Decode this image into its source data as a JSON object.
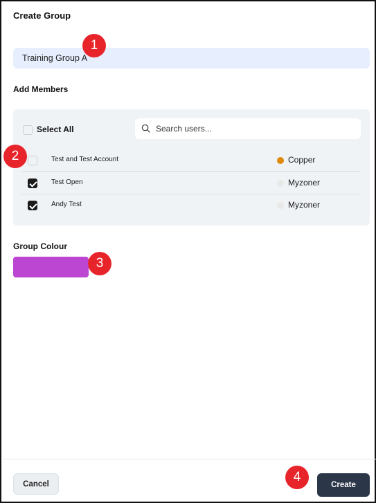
{
  "dialog": {
    "title": "Create Group",
    "group_name_value": "Training Group A"
  },
  "members": {
    "section_label": "Add Members",
    "select_all_label": "Select All",
    "select_all_checked": false,
    "search_placeholder": "Search users...",
    "rows": [
      {
        "name": "Test and Test Account",
        "level": "Copper",
        "checked": false,
        "dot_color": "#e08a0c"
      },
      {
        "name": "Test Open",
        "level": "Myzoner",
        "checked": true,
        "dot_color": "#e8e8e6"
      },
      {
        "name": "Andy Test",
        "level": "Myzoner",
        "checked": true,
        "dot_color": "#e8e8e6"
      }
    ]
  },
  "colour": {
    "section_label": "Group Colour",
    "value": "#bc45d2"
  },
  "footer": {
    "cancel_label": "Cancel",
    "create_label": "Create"
  },
  "annotations": [
    "1",
    "2",
    "3",
    "4"
  ],
  "colors": {
    "input_bg": "#e7efff",
    "panel_bg": "#f0f3f6",
    "create_bg": "#2b3649",
    "badge": "#e8242b"
  }
}
